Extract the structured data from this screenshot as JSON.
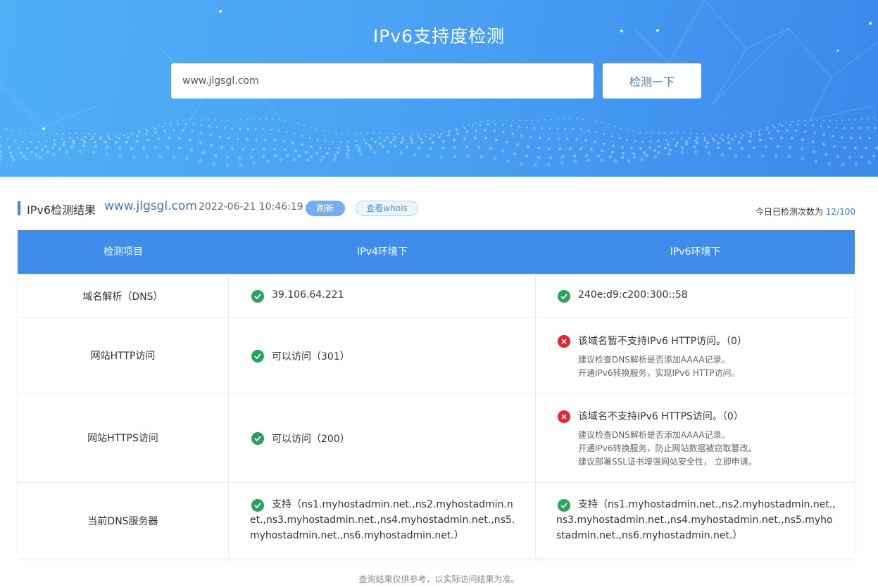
{
  "hero": {
    "title": "IPv6支持度检测",
    "search_value": "www.jlgsgl.com",
    "button_label": "检测一下"
  },
  "result": {
    "label": "IPv6检测结果",
    "domain": "www.jlgsgl.com",
    "time": "2022-06-21 10:46:19",
    "refresh_label": "刷新",
    "whois_label": "查看whois",
    "quota_prefix": "今日已检测次数为",
    "quota_count": "12/100"
  },
  "table": {
    "headers": [
      "检测项目",
      "IPv4环境下",
      "IPv6环境下"
    ],
    "rows": [
      {
        "item": "域名解析（DNS）",
        "ipv4": {
          "status": "ok",
          "text": "39.106.64.221"
        },
        "ipv6": {
          "status": "ok",
          "text": "240e:d9:c200:300::58"
        }
      },
      {
        "item": "网站HTTP访问",
        "ipv4": {
          "status": "ok",
          "text": "可以访问（301）"
        },
        "ipv6": {
          "status": "error",
          "text": "该域名暂不支持IPv6 HTTP访问。（0）",
          "notes": [
            "建议检查DNS解析是否添加AAAA记录。",
            "开通IPv6转换服务，实现IPv6 HTTP访问。"
          ]
        }
      },
      {
        "item": "网站HTTPS访问",
        "ipv4": {
          "status": "ok",
          "text": "可以访问（200）"
        },
        "ipv6": {
          "status": "error",
          "text": "该域名不支持IPv6 HTTPS访问。（0）",
          "notes": [
            "建议检查DNS解析是否添加AAAA记录。",
            "开通IPv6转换服务，防止网站数据被窃取篡改。",
            "建议部署SSL证书增强网站安全性， 立即申请。"
          ]
        }
      },
      {
        "item": "当前DNS服务器",
        "ipv4": {
          "status": "ok",
          "text": "支持（ns1.myhostadmin.net.,ns2.myhostadmin.net.,ns3.myhostadmin.net.,ns4.myhostadmin.net.,ns5.myhostadmin.net.,ns6.myhostadmin.net.）"
        },
        "ipv6": {
          "status": "ok",
          "text": "支持（ns1.myhostadmin.net.,ns2.myhostadmin.net.,ns3.myhostadmin.net.,ns4.myhostadmin.net.,ns5.myhostadmin.net.,ns6.myhostadmin.net.）"
        }
      }
    ]
  },
  "footer": {
    "note": "查询结果仅供参考，以实际访问结果为准。"
  },
  "colors": {
    "accent": "#3f8cea",
    "ok": "#27a45a",
    "error": "#e5262f",
    "link": "#3d74c4"
  }
}
